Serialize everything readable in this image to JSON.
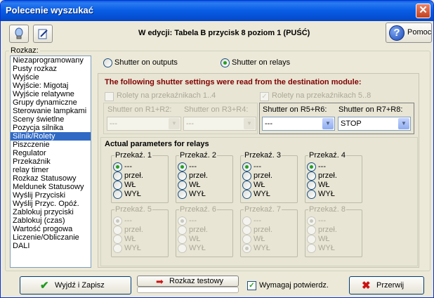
{
  "window": {
    "title": "Polecenie wyszukać",
    "close_glyph": "✕"
  },
  "toolbar": {
    "btn1_icon": "bulb-icon",
    "btn2_icon": "edit-icon",
    "edit_title": "W edycji: Tabela B przycisk 8 poziom 1  (PUŚĆ)",
    "help_label": "Pomoc",
    "help_glyph": "?"
  },
  "command": {
    "label": "Rozkaz:",
    "items": [
      "Niezaprogramowany",
      "Pusty rozkaz",
      "Wyjście",
      "Wyjście: Migotaj",
      "Wyjście relatywne",
      "Grupy dynamiczne",
      "Sterowanie lampkami",
      "Sceny świetlne",
      "Pozycja silnika",
      "Silnik/Rolety",
      "Piszczenie",
      "Regulator",
      "Przekaźnik",
      "relay timer",
      "Rozkaz Statusowy",
      "Meldunek Statusowy",
      "Wyślij Przyciski",
      "Wyślij Przyc. Opóź.",
      "Zablokuj przyciski",
      "Zablokuj (czas)",
      "Wartość progowa",
      "Liczenie/Obliczanie",
      "DALI"
    ],
    "selected_index": 9
  },
  "mode": {
    "outputs_label": "Shutter on outputs",
    "relays_label": "Shutter on relays",
    "selected": "relays"
  },
  "settings": {
    "warning": "The following shutter settings were read from the destination module:",
    "chk14_label": "Rolety na przekaźnikach 1..4",
    "chk58_label": "Rolety na przekaźnikach 5..8",
    "chk14_checked": false,
    "chk58_checked": true,
    "r1r2_label": "Shutter on R1+R2:",
    "r3r4_label": "Shutter on R3+R4:",
    "r5r6_label": "Shutter on R5+R6:",
    "r7r8_label": "Shutter on R7+R8:",
    "r1r2_value": "---",
    "r3r4_value": "---",
    "r5r6_value": "---",
    "r7r8_value": "STOP"
  },
  "relays": {
    "section_label": "Actual parameters for relays",
    "options": [
      "---",
      "przeł.",
      "WŁ",
      "WYŁ"
    ],
    "groups": [
      {
        "title": "Przekaź. 1",
        "selected": 0
      },
      {
        "title": "Przekaź. 2",
        "selected": 0
      },
      {
        "title": "Przekaź. 3",
        "selected": 0
      },
      {
        "title": "Przekaź. 4",
        "selected": 0
      },
      {
        "title": "Przekaź. 5",
        "selected": 0
      },
      {
        "title": "Przekaź. 6",
        "selected": 0
      },
      {
        "title": "Przekaź. 7",
        "selected": 3
      },
      {
        "title": "Przekaź. 8",
        "selected": 0
      }
    ]
  },
  "footer": {
    "exit_label": "Wyjdź i Zapisz",
    "test_label": "Rozkaz testowy",
    "confirm_label": "Wymagaj potwierdz.",
    "confirm_checked": true,
    "cancel_label": "Przerwij",
    "check_glyph": "✔",
    "cancel_glyph": "✖",
    "test_glyph": "➡",
    "colors": {
      "check": "#1f9a1f",
      "cancel": "#cc1111",
      "test": "#cc1111"
    }
  }
}
